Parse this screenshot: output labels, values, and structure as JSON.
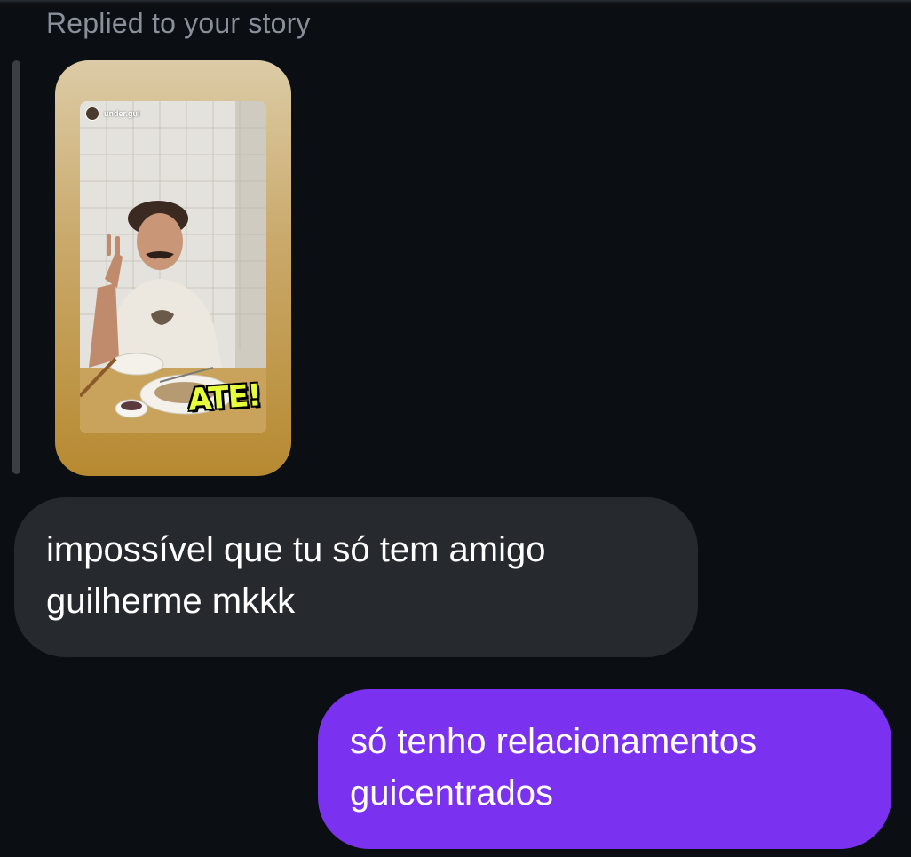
{
  "header": {
    "replied_label": "Replied to your story"
  },
  "story": {
    "username": "under.gui",
    "sticker_text": "ATE!"
  },
  "messages": [
    {
      "direction": "received",
      "text": "impossível que tu só tem amigo\nguilherme mkkk"
    },
    {
      "direction": "sent",
      "text": "só tenho relacionamentos\nguicentrados"
    }
  ],
  "colors": {
    "background": "#0b0f14",
    "received_bubble": "#26292e",
    "sent_bubble": "#7b32f0",
    "label_gray": "#8a9099"
  }
}
